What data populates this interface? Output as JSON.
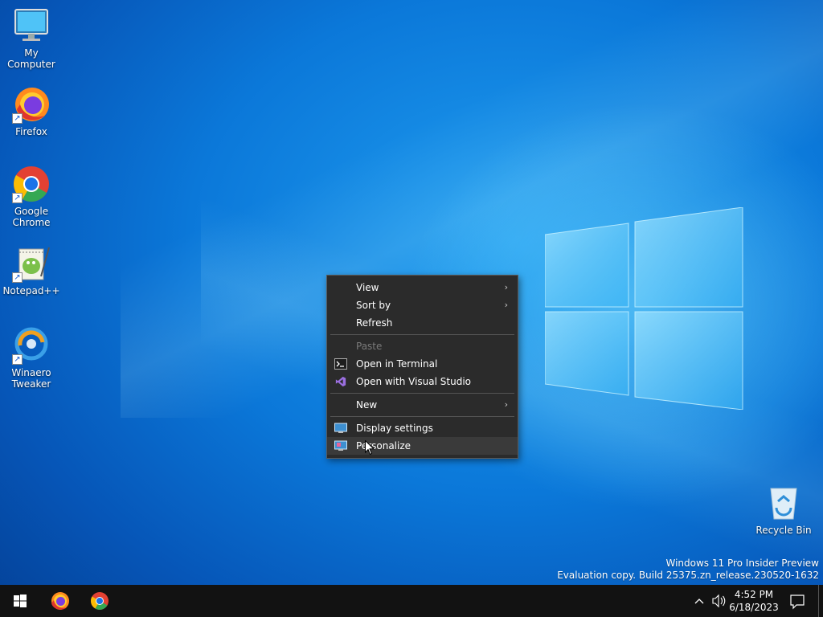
{
  "desktop": {
    "icons": [
      {
        "label": "My Computer",
        "icon": "monitor-icon"
      },
      {
        "label": "Firefox",
        "icon": "firefox-icon"
      },
      {
        "label": "Google Chrome",
        "icon": "chrome-icon"
      },
      {
        "label": "Notepad++",
        "icon": "notepadpp-icon"
      },
      {
        "label": "Winaero Tweaker",
        "icon": "winaero-icon"
      },
      {
        "label": "Recycle Bin",
        "icon": "recycle-bin-icon"
      }
    ],
    "watermark": {
      "line1": "Windows 11 Pro Insider Preview",
      "line2": "Evaluation copy. Build 25375.zn_release.230520-1632"
    }
  },
  "context_menu": {
    "view": "View",
    "sort_by": "Sort by",
    "refresh": "Refresh",
    "paste": "Paste",
    "open_terminal": "Open in Terminal",
    "open_vs": "Open with Visual Studio",
    "new": "New",
    "display_settings": "Display settings",
    "personalize": "Personalize",
    "submenu_arrow": "›"
  },
  "taskbar": {
    "time": "4:52 PM",
    "date": "6/18/2023",
    "pinned": [
      "start-icon",
      "firefox-icon",
      "chrome-icon"
    ]
  },
  "colors": {
    "menu_bg": "#2b2b2b",
    "taskbar_bg": "#121212",
    "desktop_accent": "#0b78d9"
  }
}
